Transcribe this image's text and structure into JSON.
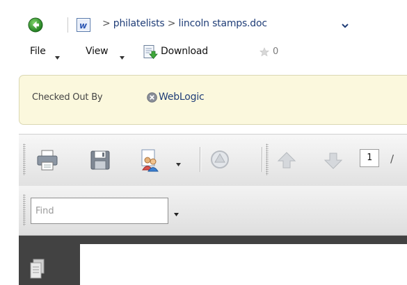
{
  "breadcrumb": {
    "separator": ">",
    "folder": "philatelists",
    "document": "lincoln stamps.doc"
  },
  "menu": {
    "file": "File",
    "view": "View",
    "download": "Download",
    "favorite_count": "0"
  },
  "checkout": {
    "label": "Checked Out By",
    "user": "WebLogic"
  },
  "toolbar": {
    "page_number": "1",
    "page_suffix_glyph": "/",
    "icons": [
      "print-icon",
      "save-icon",
      "share-users-icon",
      "annotation-icon",
      "previous-page-icon",
      "next-page-icon"
    ]
  },
  "find": {
    "placeholder": "Find"
  },
  "viewer": {
    "sidebar_icon": "thumbnails-icon"
  },
  "colors": {
    "link": "#1f3d77",
    "banner_bg": "#fbf8dd",
    "viewer_bg": "#424242",
    "back_button": "#2f9e2f"
  }
}
